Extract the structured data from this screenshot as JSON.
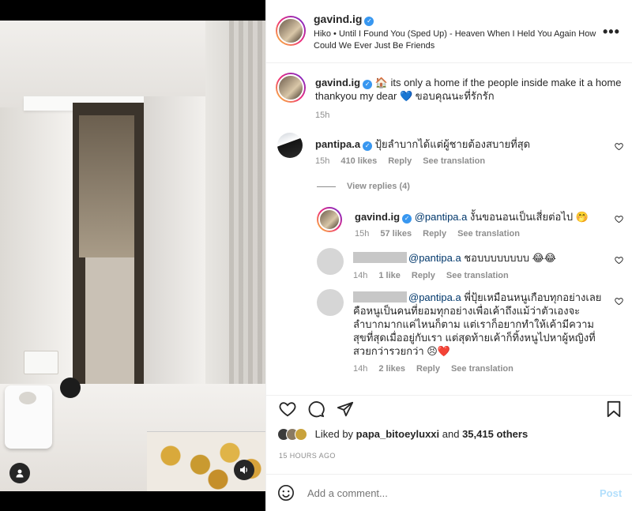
{
  "post": {
    "author": "gavind.ig",
    "audio": "Hiko • Until I Found You (Sped Up) - Heaven When I Held You Again How Could We Ever Just Be Friends"
  },
  "caption": {
    "author": "gavind.ig",
    "text": "🏠 its only a home if the people inside make it a home thankyou my dear 💙 ขอบคุณนะที่รักรัก",
    "time": "15h"
  },
  "comments": [
    {
      "author": "pantipa.a",
      "text": "ปุ้ยลำบากได้แต่ผู้ชายต้องสบายที่สุด",
      "time": "15h",
      "likes": "410 likes",
      "reply": "Reply",
      "translate": "See translation",
      "view_replies": "View replies (4)"
    }
  ],
  "replies": [
    {
      "author": "gavind.ig",
      "mention": "@pantipa.a",
      "text": " งั้นขอนอนเป็นเสี่ยต่อไป 🤭",
      "time": "15h",
      "likes": "57 likes",
      "reply": "Reply",
      "translate": "See translation"
    },
    {
      "mention": "@pantipa.a",
      "text": " ชอบบบบบบบบ 😂😂",
      "time": "14h",
      "likes": "1 like",
      "reply": "Reply",
      "translate": "See translation"
    },
    {
      "mention": "@pantipa.a",
      "text": " พี่ปุ้ยเหมือนหนูเกือบทุกอย่างเลย คือหนูเป็นคนที่ยอมทุกอย่างเพื่อเค้าถึงแม้ว่าตัวเองจะลำบากมากแค่ไหนก็ตาม แต่เราก็อยากทำให้เค้ามีความสุขที่สุดเมื่ออยู่กับเรา แต่สุดท้ายเค้าก็ทิ้งหนูไปหาผู้หญิงที่สวยกว่ารวยกว่า 😣❤️",
      "time": "14h",
      "likes": "2 likes",
      "reply": "Reply",
      "translate": "See translation"
    }
  ],
  "footer": {
    "liked_by_prefix": "Liked by ",
    "liked_by_user": "papa_bitoeyluxxi",
    "liked_by_and": " and ",
    "liked_by_count": "35,415 others",
    "posted": "15 HOURS AGO",
    "comment_placeholder": "Add a comment...",
    "post_label": "Post"
  },
  "colors": {
    "verified": "#3897f0",
    "link": "#00376b",
    "post_disabled": "#b2dffc",
    "heart_red": "#ed4956"
  },
  "icons": [
    "heart-icon",
    "comment-icon",
    "share-icon",
    "save-icon",
    "emoji-icon",
    "more-icon",
    "user-tag-icon",
    "sound-icon"
  ]
}
